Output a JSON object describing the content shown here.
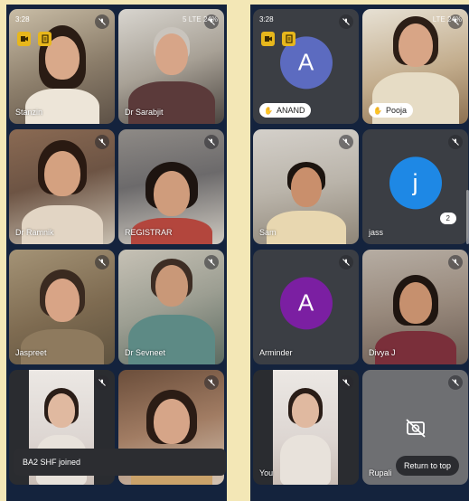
{
  "left_phone": {
    "status_time": "3:28",
    "status_right": "5 LTE 24%",
    "tiles": [
      {
        "name": "Stanzin"
      },
      {
        "name": "Dr Sarabjit"
      },
      {
        "name": "Dr Ramnik"
      },
      {
        "name": "REGISTRAR"
      },
      {
        "name": "Jaspreet"
      },
      {
        "name": "Dr Sevneet"
      },
      {
        "name": ""
      },
      {
        "name": ""
      }
    ],
    "toast": "BA2 SHF joined"
  },
  "right_phone": {
    "status_time": "3:28",
    "status_right": "LTE 24%",
    "tiles": [
      {
        "name": "ANAND",
        "initial": "A",
        "color": "#5c6bc0"
      },
      {
        "name": "Pooja"
      },
      {
        "name": "Sam"
      },
      {
        "name": "jass",
        "initial": "j",
        "color": "#1e88e5",
        "count": "2"
      },
      {
        "name": "Arminder",
        "initial": "A",
        "color": "#7b1fa2"
      },
      {
        "name": "Divya J"
      },
      {
        "name": "You"
      },
      {
        "name": "Rupali"
      }
    ],
    "return_to_top": "Return to top"
  },
  "colors": {
    "background": "#f3e7b6",
    "screen": "#14233d",
    "indicator": "#e7b71c"
  }
}
